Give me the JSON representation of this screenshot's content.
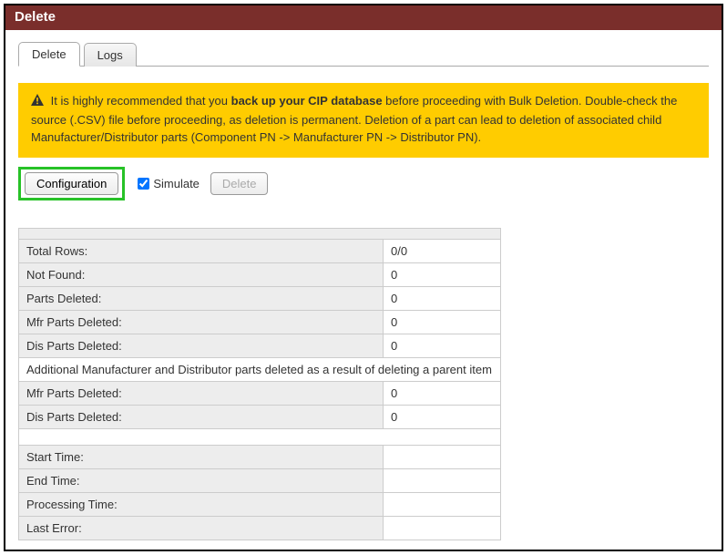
{
  "window": {
    "title": "Delete"
  },
  "tabs": {
    "active": "Delete",
    "inactive": "Logs"
  },
  "warning": {
    "pre": "It is highly recommended that you ",
    "bold": "back up your CIP database",
    "post": " before proceeding with Bulk Deletion. Double-check the source (.CSV) file before proceeding, as deletion is permanent. Deletion of a part can lead to deletion of associated child Manufacturer/Distributor parts (Component PN -> Manufacturer PN -> Distributor PN)."
  },
  "controls": {
    "config": "Configuration",
    "simulate": "Simulate",
    "delete": "Delete"
  },
  "stats": {
    "totalRowsLabel": "Total Rows:",
    "totalRows": "0/0",
    "notFoundLabel": "Not Found:",
    "notFound": "0",
    "partsDeletedLabel": "Parts Deleted:",
    "partsDeleted": "0",
    "mfrDeletedLabel": "Mfr Parts Deleted:",
    "mfrDeleted": "0",
    "disDeletedLabel": "Dis Parts Deleted:",
    "disDeleted": "0",
    "cascadeNote": "Additional Manufacturer and Distributor parts deleted as a result of deleting a parent item",
    "mfr2Label": "Mfr Parts Deleted:",
    "mfr2": "0",
    "dis2Label": "Dis Parts Deleted:",
    "dis2": "0",
    "startLabel": "Start Time:",
    "start": "",
    "endLabel": "End Time:",
    "end": "",
    "procLabel": "Processing Time:",
    "proc": "",
    "errLabel": "Last Error:",
    "err": ""
  }
}
